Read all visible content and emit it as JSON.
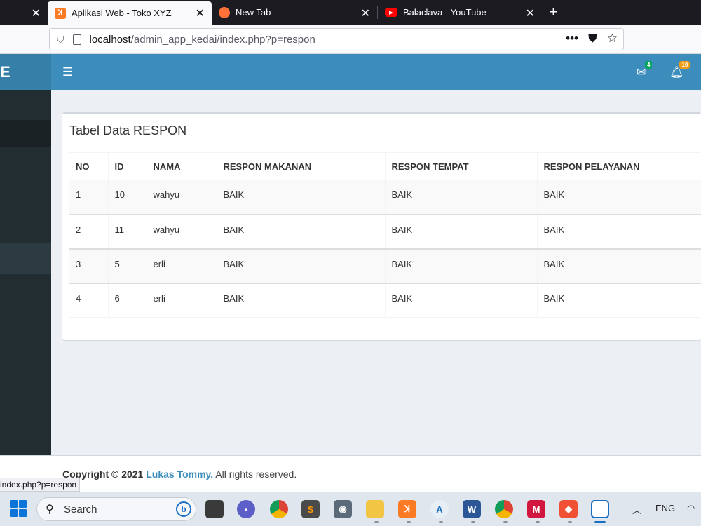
{
  "browser": {
    "tabs": [
      {
        "title": ""
      },
      {
        "title": "Aplikasi Web - Toko XYZ"
      },
      {
        "title": "New Tab"
      },
      {
        "title": "Balaclava - YouTube"
      }
    ],
    "url_host": "localhost",
    "url_path": "/admin_app_kedai/index.php?p=respon",
    "status_url": "index.php?p=respon"
  },
  "header": {
    "logo_text": "E",
    "mail_badge": "4",
    "bell_badge": "10",
    "colors": {
      "header": "#3c8dbc",
      "logo": "#367fa9",
      "sidebar": "#222d32",
      "mail_badge": "#00a65a",
      "bell_badge": "#f39c12"
    }
  },
  "box": {
    "title": "Tabel Data RESPON"
  },
  "table": {
    "columns": [
      "NO",
      "ID",
      "NAMA",
      "RESPON MAKANAN",
      "RESPON TEMPAT",
      "RESPON PELAYANAN"
    ],
    "rows": [
      [
        "1",
        "10",
        "wahyu",
        "BAIK",
        "BAIK",
        "BAIK"
      ],
      [
        "2",
        "11",
        "wahyu",
        "BAIK",
        "BAIK",
        "BAIK"
      ],
      [
        "3",
        "5",
        "erli",
        "BAIK",
        "BAIK",
        "BAIK"
      ],
      [
        "4",
        "6",
        "erli",
        "BAIK",
        "BAIK",
        "BAIK"
      ]
    ]
  },
  "footer": {
    "prefix": "Copyright © 2021 ",
    "author": "Lukas Tommy.",
    "suffix": " All rights reserved."
  },
  "taskbar": {
    "search_label": "Search",
    "language": "ENG",
    "icons": [
      "task-view-icon",
      "chat-icon",
      "chrome-icon",
      "sublime-text-icon",
      "camera-icon",
      "file-explorer-icon",
      "xampp-icon",
      "app-store-icon",
      "word-icon",
      "chrome-profile-icon",
      "mirror-app-icon",
      "git-icon",
      "firefox-active-icon"
    ]
  }
}
